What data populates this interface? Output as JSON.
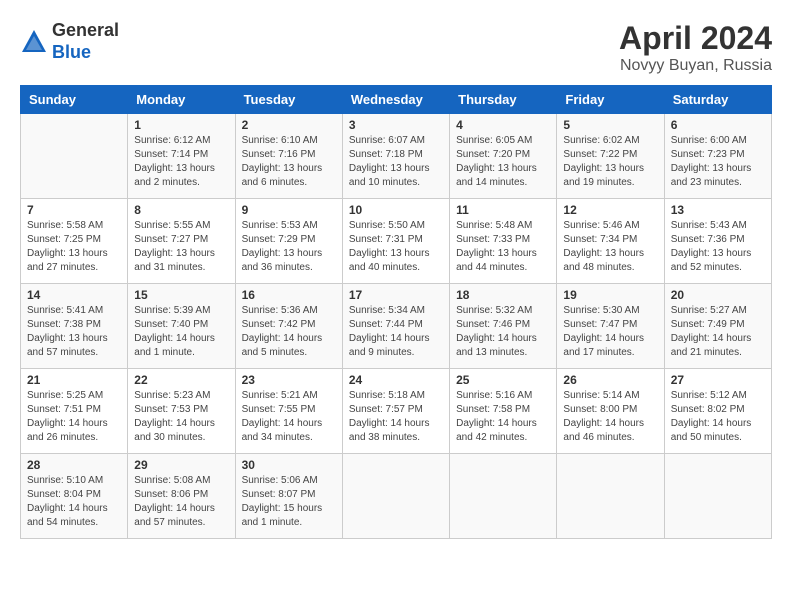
{
  "header": {
    "logo_line1": "General",
    "logo_line2": "Blue",
    "title": "April 2024",
    "subtitle": "Novyy Buyan, Russia"
  },
  "days_of_week": [
    "Sunday",
    "Monday",
    "Tuesday",
    "Wednesday",
    "Thursday",
    "Friday",
    "Saturday"
  ],
  "weeks": [
    [
      {
        "day": "",
        "info": ""
      },
      {
        "day": "1",
        "info": "Sunrise: 6:12 AM\nSunset: 7:14 PM\nDaylight: 13 hours\nand 2 minutes."
      },
      {
        "day": "2",
        "info": "Sunrise: 6:10 AM\nSunset: 7:16 PM\nDaylight: 13 hours\nand 6 minutes."
      },
      {
        "day": "3",
        "info": "Sunrise: 6:07 AM\nSunset: 7:18 PM\nDaylight: 13 hours\nand 10 minutes."
      },
      {
        "day": "4",
        "info": "Sunrise: 6:05 AM\nSunset: 7:20 PM\nDaylight: 13 hours\nand 14 minutes."
      },
      {
        "day": "5",
        "info": "Sunrise: 6:02 AM\nSunset: 7:22 PM\nDaylight: 13 hours\nand 19 minutes."
      },
      {
        "day": "6",
        "info": "Sunrise: 6:00 AM\nSunset: 7:23 PM\nDaylight: 13 hours\nand 23 minutes."
      }
    ],
    [
      {
        "day": "7",
        "info": "Sunrise: 5:58 AM\nSunset: 7:25 PM\nDaylight: 13 hours\nand 27 minutes."
      },
      {
        "day": "8",
        "info": "Sunrise: 5:55 AM\nSunset: 7:27 PM\nDaylight: 13 hours\nand 31 minutes."
      },
      {
        "day": "9",
        "info": "Sunrise: 5:53 AM\nSunset: 7:29 PM\nDaylight: 13 hours\nand 36 minutes."
      },
      {
        "day": "10",
        "info": "Sunrise: 5:50 AM\nSunset: 7:31 PM\nDaylight: 13 hours\nand 40 minutes."
      },
      {
        "day": "11",
        "info": "Sunrise: 5:48 AM\nSunset: 7:33 PM\nDaylight: 13 hours\nand 44 minutes."
      },
      {
        "day": "12",
        "info": "Sunrise: 5:46 AM\nSunset: 7:34 PM\nDaylight: 13 hours\nand 48 minutes."
      },
      {
        "day": "13",
        "info": "Sunrise: 5:43 AM\nSunset: 7:36 PM\nDaylight: 13 hours\nand 52 minutes."
      }
    ],
    [
      {
        "day": "14",
        "info": "Sunrise: 5:41 AM\nSunset: 7:38 PM\nDaylight: 13 hours\nand 57 minutes."
      },
      {
        "day": "15",
        "info": "Sunrise: 5:39 AM\nSunset: 7:40 PM\nDaylight: 14 hours\nand 1 minute."
      },
      {
        "day": "16",
        "info": "Sunrise: 5:36 AM\nSunset: 7:42 PM\nDaylight: 14 hours\nand 5 minutes."
      },
      {
        "day": "17",
        "info": "Sunrise: 5:34 AM\nSunset: 7:44 PM\nDaylight: 14 hours\nand 9 minutes."
      },
      {
        "day": "18",
        "info": "Sunrise: 5:32 AM\nSunset: 7:46 PM\nDaylight: 14 hours\nand 13 minutes."
      },
      {
        "day": "19",
        "info": "Sunrise: 5:30 AM\nSunset: 7:47 PM\nDaylight: 14 hours\nand 17 minutes."
      },
      {
        "day": "20",
        "info": "Sunrise: 5:27 AM\nSunset: 7:49 PM\nDaylight: 14 hours\nand 21 minutes."
      }
    ],
    [
      {
        "day": "21",
        "info": "Sunrise: 5:25 AM\nSunset: 7:51 PM\nDaylight: 14 hours\nand 26 minutes."
      },
      {
        "day": "22",
        "info": "Sunrise: 5:23 AM\nSunset: 7:53 PM\nDaylight: 14 hours\nand 30 minutes."
      },
      {
        "day": "23",
        "info": "Sunrise: 5:21 AM\nSunset: 7:55 PM\nDaylight: 14 hours\nand 34 minutes."
      },
      {
        "day": "24",
        "info": "Sunrise: 5:18 AM\nSunset: 7:57 PM\nDaylight: 14 hours\nand 38 minutes."
      },
      {
        "day": "25",
        "info": "Sunrise: 5:16 AM\nSunset: 7:58 PM\nDaylight: 14 hours\nand 42 minutes."
      },
      {
        "day": "26",
        "info": "Sunrise: 5:14 AM\nSunset: 8:00 PM\nDaylight: 14 hours\nand 46 minutes."
      },
      {
        "day": "27",
        "info": "Sunrise: 5:12 AM\nSunset: 8:02 PM\nDaylight: 14 hours\nand 50 minutes."
      }
    ],
    [
      {
        "day": "28",
        "info": "Sunrise: 5:10 AM\nSunset: 8:04 PM\nDaylight: 14 hours\nand 54 minutes."
      },
      {
        "day": "29",
        "info": "Sunrise: 5:08 AM\nSunset: 8:06 PM\nDaylight: 14 hours\nand 57 minutes."
      },
      {
        "day": "30",
        "info": "Sunrise: 5:06 AM\nSunset: 8:07 PM\nDaylight: 15 hours\nand 1 minute."
      },
      {
        "day": "",
        "info": ""
      },
      {
        "day": "",
        "info": ""
      },
      {
        "day": "",
        "info": ""
      },
      {
        "day": "",
        "info": ""
      }
    ]
  ]
}
